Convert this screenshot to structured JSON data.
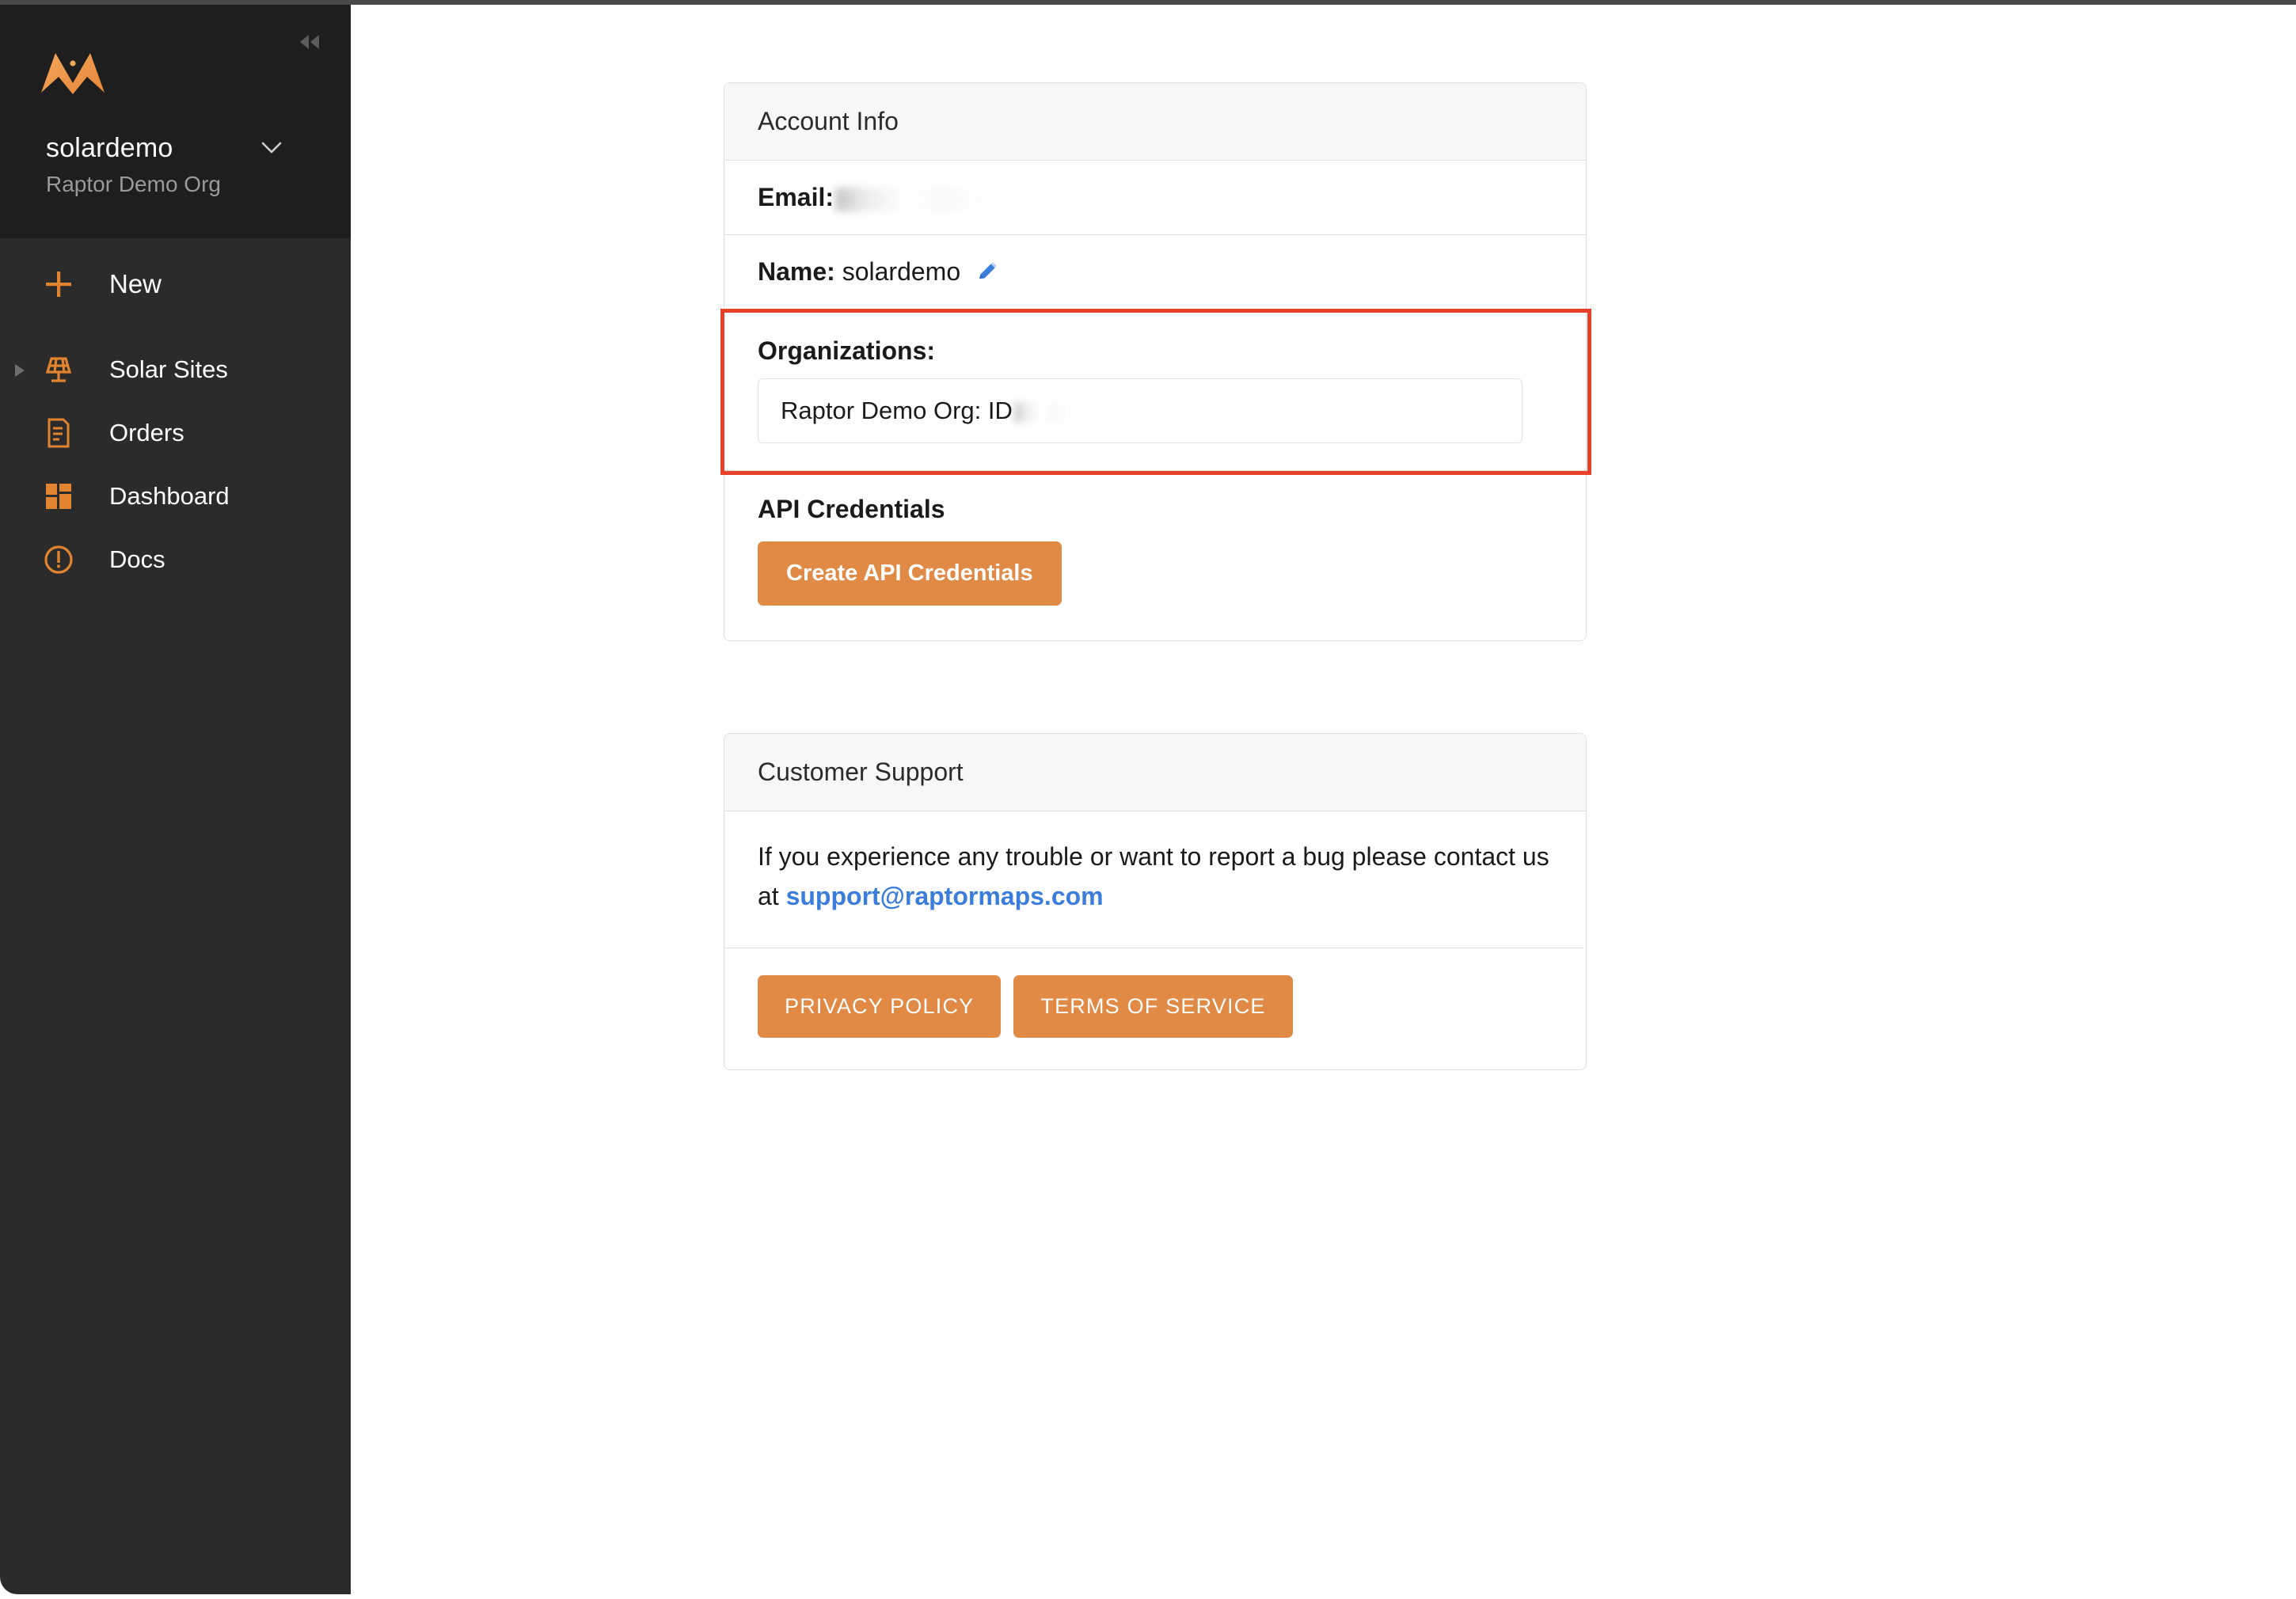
{
  "sidebar": {
    "collapse_icon": "double-chevron-left-icon",
    "logo_icon": "raptor-maps-logo",
    "account": {
      "username": "solardemo",
      "organization": "Raptor Demo Org",
      "caret_icon": "chevron-down-icon"
    },
    "nav": [
      {
        "label": "New",
        "icon": "plus-icon",
        "expandable": false
      },
      {
        "label": "Solar Sites",
        "icon": "solar-panel-icon",
        "expandable": true
      },
      {
        "label": "Orders",
        "icon": "document-icon",
        "expandable": false
      },
      {
        "label": "Dashboard",
        "icon": "grid-dashboard-icon",
        "expandable": false
      },
      {
        "label": "Docs",
        "icon": "exclamation-circle-icon",
        "expandable": false
      }
    ]
  },
  "account_card": {
    "header": "Account Info",
    "email_label": "Email:",
    "email_value": "",
    "name_label": "Name:",
    "name_value": "solardemo",
    "name_edit_icon": "pencil-edit-icon",
    "organizations_label": "Organizations:",
    "organizations": [
      {
        "text": "Raptor Demo Org: ID"
      }
    ],
    "api_credentials_label": "API Credentials",
    "create_api_button": "Create API Credentials"
  },
  "support_card": {
    "header": "Customer Support",
    "body_text_before": "If you experience any trouble or want to report a bug please contact us at ",
    "support_email": "support@raptormaps.com",
    "privacy_button": "PRIVACY POLICY",
    "terms_button": "TERMS OF SERVICE"
  },
  "colors": {
    "accent_orange": "#e08a45",
    "icon_orange": "#e2842f",
    "highlight_red": "#e8412b",
    "link_blue": "#3b7ddd",
    "sidebar_dark": "#2b2b2b",
    "sidebar_header_dark": "#1e1e1e"
  }
}
